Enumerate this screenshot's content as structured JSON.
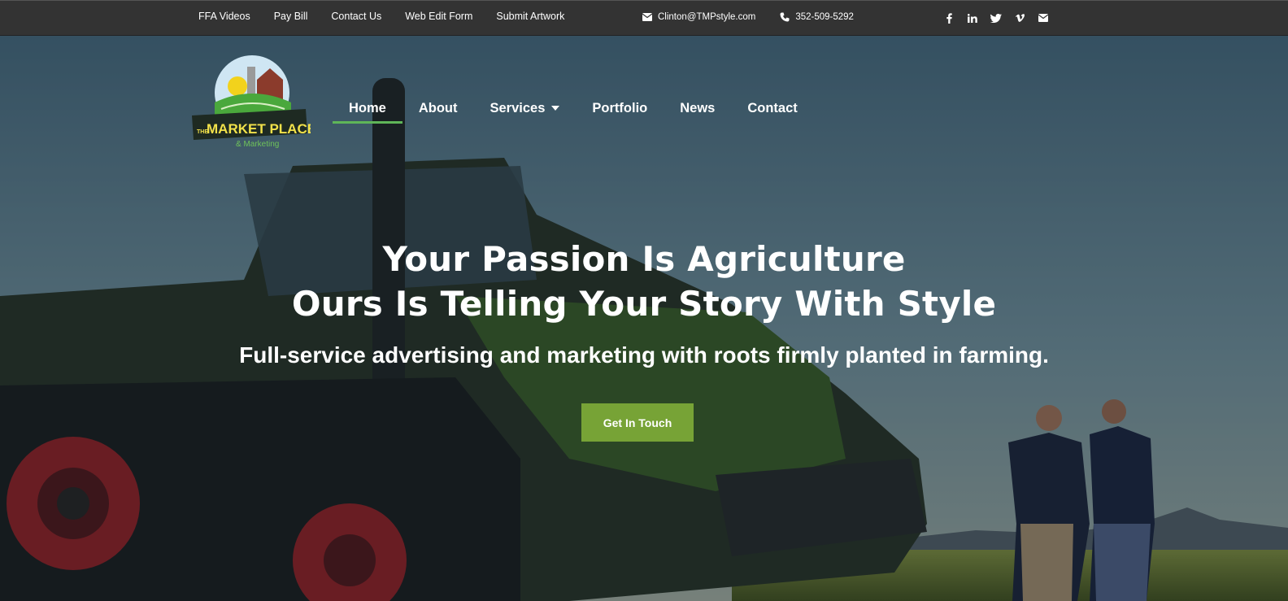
{
  "topbar": {
    "links": [
      "FFA Videos",
      "Pay Bill",
      "Contact Us",
      "Web Edit Form",
      "Submit Artwork"
    ],
    "email": "Clinton@TMPstyle.com",
    "phone": "352-509-5292",
    "social_icons": [
      "facebook-icon",
      "linkedin-icon",
      "twitter-icon",
      "vimeo-icon",
      "envelope-icon"
    ]
  },
  "logo": {
    "line1": "THE",
    "line2": "MARKET PLACE",
    "line3": "& Marketing"
  },
  "nav": {
    "items": [
      "Home",
      "About",
      "Services",
      "Portfolio",
      "News",
      "Contact"
    ],
    "active": "Home"
  },
  "hero": {
    "headline_1": "Your Passion Is Agriculture",
    "headline_2": "Ours Is Telling Your Story With Style",
    "subhead": "Full-service advertising and marketing with roots firmly planted in farming.",
    "cta_label": "Get In Touch"
  },
  "colors": {
    "topbar_bg": "#333333",
    "accent_green": "#77a336",
    "nav_underline": "#5fb558"
  }
}
